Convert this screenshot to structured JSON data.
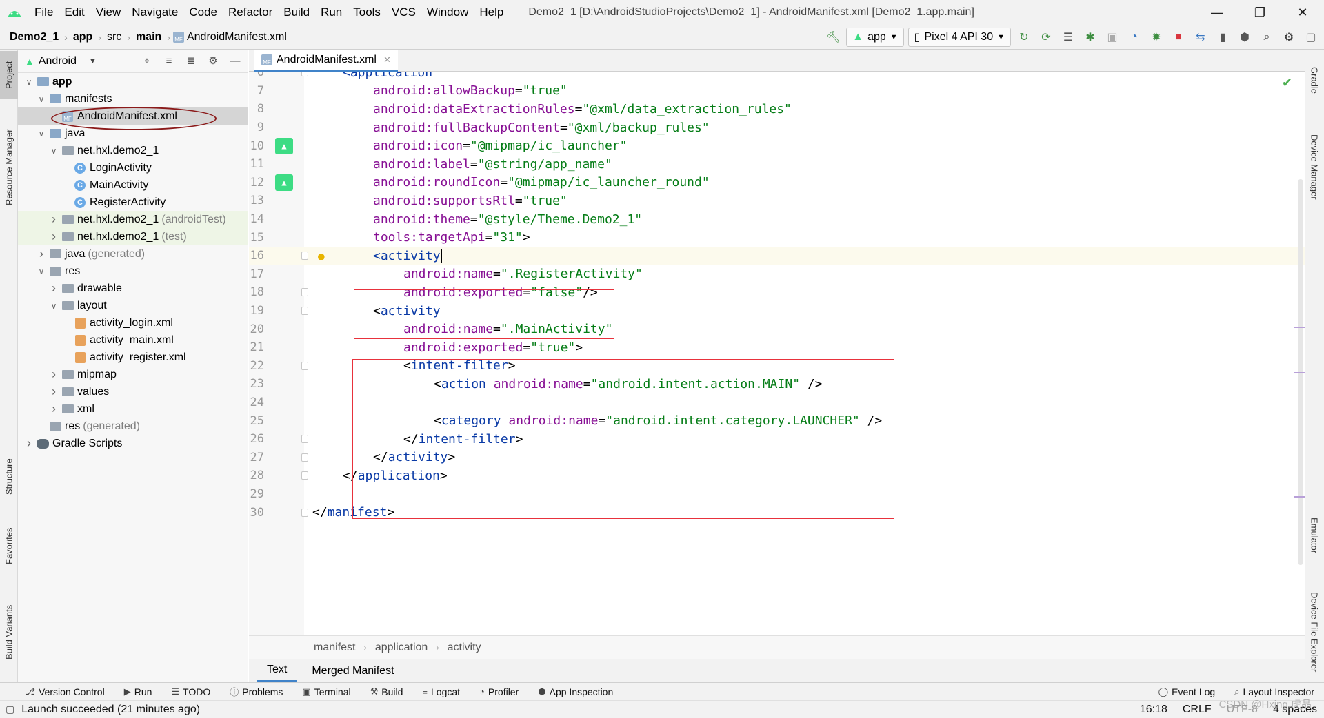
{
  "menu": {
    "items": [
      "File",
      "Edit",
      "View",
      "Navigate",
      "Code",
      "Refactor",
      "Build",
      "Run",
      "Tools",
      "VCS",
      "Window",
      "Help"
    ],
    "window_title": "Demo2_1 [D:\\AndroidStudioProjects\\Demo2_1] - AndroidManifest.xml [Demo2_1.app.main]"
  },
  "navbar": {
    "crumbs": [
      "Demo2_1",
      "app",
      "src",
      "main",
      "AndroidManifest.xml"
    ],
    "run_config": "app",
    "device": "Pixel 4 API 30"
  },
  "left_stripe": {
    "tabs": [
      "Project",
      "Resource Manager",
      "Structure",
      "Favorites",
      "Build Variants"
    ]
  },
  "right_stripe": {
    "tabs": [
      "Gradle",
      "Device Manager",
      "Emulator",
      "Device File Explorer"
    ]
  },
  "project_panel": {
    "view": "Android",
    "tree": [
      {
        "label": "app",
        "extra": "",
        "indent": 0,
        "arrow": "v",
        "icon": "folder-module",
        "bold": true
      },
      {
        "label": "manifests",
        "extra": "",
        "indent": 1,
        "arrow": "v",
        "icon": "folder"
      },
      {
        "label": "AndroidManifest.xml",
        "extra": "",
        "indent": 2,
        "arrow": "",
        "icon": "manifest",
        "selected": true
      },
      {
        "label": "java",
        "extra": "",
        "indent": 1,
        "arrow": "v",
        "icon": "folder"
      },
      {
        "label": "net.hxl.demo2_1",
        "extra": "",
        "indent": 2,
        "arrow": "v",
        "icon": "package"
      },
      {
        "label": "LoginActivity",
        "extra": "",
        "indent": 3,
        "arrow": "",
        "icon": "class"
      },
      {
        "label": "MainActivity",
        "extra": "",
        "indent": 3,
        "arrow": "",
        "icon": "class"
      },
      {
        "label": "RegisterActivity",
        "extra": "",
        "indent": 3,
        "arrow": "",
        "icon": "class"
      },
      {
        "label": "net.hxl.demo2_1",
        "extra": "(androidTest)",
        "indent": 2,
        "arrow": ">",
        "icon": "package",
        "green": true
      },
      {
        "label": "net.hxl.demo2_1",
        "extra": "(test)",
        "indent": 2,
        "arrow": ">",
        "icon": "package",
        "green": true
      },
      {
        "label": "java",
        "extra": "(generated)",
        "indent": 1,
        "arrow": ">",
        "icon": "folder-gray"
      },
      {
        "label": "res",
        "extra": "",
        "indent": 1,
        "arrow": "v",
        "icon": "folder-gray"
      },
      {
        "label": "drawable",
        "extra": "",
        "indent": 2,
        "arrow": ">",
        "icon": "package"
      },
      {
        "label": "layout",
        "extra": "",
        "indent": 2,
        "arrow": "v",
        "icon": "package"
      },
      {
        "label": "activity_login.xml",
        "extra": "",
        "indent": 3,
        "arrow": "",
        "icon": "xml"
      },
      {
        "label": "activity_main.xml",
        "extra": "",
        "indent": 3,
        "arrow": "",
        "icon": "xml"
      },
      {
        "label": "activity_register.xml",
        "extra": "",
        "indent": 3,
        "arrow": "",
        "icon": "xml"
      },
      {
        "label": "mipmap",
        "extra": "",
        "indent": 2,
        "arrow": ">",
        "icon": "package"
      },
      {
        "label": "values",
        "extra": "",
        "indent": 2,
        "arrow": ">",
        "icon": "package"
      },
      {
        "label": "xml",
        "extra": "",
        "indent": 2,
        "arrow": ">",
        "icon": "package"
      },
      {
        "label": "res",
        "extra": "(generated)",
        "indent": 1,
        "arrow": "",
        "icon": "folder-gray"
      },
      {
        "label": "Gradle Scripts",
        "extra": "",
        "indent": 0,
        "arrow": ">",
        "icon": "gradle"
      }
    ]
  },
  "editor": {
    "tab": "AndroidManifest.xml",
    "current_line": 16,
    "lines": [
      {
        "n": 6,
        "indent": 1,
        "tokens": [
          [
            "tag",
            "<application"
          ]
        ]
      },
      {
        "n": 7,
        "indent": 2,
        "tokens": [
          [
            "attr",
            "android:allowBackup"
          ],
          [
            "pun",
            "="
          ],
          [
            "val",
            "\"true\""
          ]
        ]
      },
      {
        "n": 8,
        "indent": 2,
        "tokens": [
          [
            "attr",
            "android:dataExtractionRules"
          ],
          [
            "pun",
            "="
          ],
          [
            "val",
            "\"@xml/data_extraction_rules\""
          ]
        ]
      },
      {
        "n": 9,
        "indent": 2,
        "tokens": [
          [
            "attr",
            "android:fullBackupContent"
          ],
          [
            "pun",
            "="
          ],
          [
            "val",
            "\"@xml/backup_rules\""
          ]
        ]
      },
      {
        "n": 10,
        "indent": 2,
        "tokens": [
          [
            "attr",
            "android:icon"
          ],
          [
            "pun",
            "="
          ],
          [
            "val",
            "\"@mipmap/ic_launcher\""
          ]
        ]
      },
      {
        "n": 11,
        "indent": 2,
        "tokens": [
          [
            "attr",
            "android:label"
          ],
          [
            "pun",
            "="
          ],
          [
            "val",
            "\"@string/app_name\""
          ]
        ]
      },
      {
        "n": 12,
        "indent": 2,
        "tokens": [
          [
            "attr",
            "android:roundIcon"
          ],
          [
            "pun",
            "="
          ],
          [
            "val",
            "\"@mipmap/ic_launcher_round\""
          ]
        ]
      },
      {
        "n": 13,
        "indent": 2,
        "tokens": [
          [
            "attr",
            "android:supportsRtl"
          ],
          [
            "pun",
            "="
          ],
          [
            "val",
            "\"true\""
          ]
        ]
      },
      {
        "n": 14,
        "indent": 2,
        "tokens": [
          [
            "attr",
            "android:theme"
          ],
          [
            "pun",
            "="
          ],
          [
            "val",
            "\"@style/Theme.Demo2_1\""
          ]
        ]
      },
      {
        "n": 15,
        "indent": 2,
        "tokens": [
          [
            "attr",
            "tools:targetApi"
          ],
          [
            "pun",
            "="
          ],
          [
            "val",
            "\"31\""
          ],
          [
            "pun",
            ">"
          ]
        ]
      },
      {
        "n": 16,
        "indent": 2,
        "tokens": [
          [
            "tag",
            "<activity"
          ]
        ],
        "cursor": true
      },
      {
        "n": 17,
        "indent": 3,
        "tokens": [
          [
            "attr",
            "android:name"
          ],
          [
            "pun",
            "="
          ],
          [
            "val",
            "\".RegisterActivity\""
          ]
        ]
      },
      {
        "n": 18,
        "indent": 3,
        "tokens": [
          [
            "attr",
            "android:exported"
          ],
          [
            "pun",
            "="
          ],
          [
            "val",
            "\"false\""
          ],
          [
            "pun",
            "/>"
          ]
        ]
      },
      {
        "n": 19,
        "indent": 2,
        "tokens": [
          [
            "pun",
            "<"
          ],
          [
            "tag",
            "activity"
          ]
        ]
      },
      {
        "n": 20,
        "indent": 3,
        "tokens": [
          [
            "attr",
            "android:name"
          ],
          [
            "pun",
            "="
          ],
          [
            "val",
            "\".MainActivity\""
          ]
        ]
      },
      {
        "n": 21,
        "indent": 3,
        "tokens": [
          [
            "attr",
            "android:exported"
          ],
          [
            "pun",
            "="
          ],
          [
            "val",
            "\"true\""
          ],
          [
            "pun",
            ">"
          ]
        ]
      },
      {
        "n": 22,
        "indent": 3,
        "tokens": [
          [
            "pun",
            "<"
          ],
          [
            "tag",
            "intent-filter"
          ],
          [
            "pun",
            ">"
          ]
        ]
      },
      {
        "n": 23,
        "indent": 4,
        "tokens": [
          [
            "pun",
            "<"
          ],
          [
            "tag",
            "action "
          ],
          [
            "attr",
            "android:name"
          ],
          [
            "pun",
            "="
          ],
          [
            "val",
            "\"android.intent.action.MAIN\""
          ],
          [
            "pun",
            " />"
          ]
        ]
      },
      {
        "n": 24,
        "indent": 0,
        "tokens": []
      },
      {
        "n": 25,
        "indent": 4,
        "tokens": [
          [
            "pun",
            "<"
          ],
          [
            "tag",
            "category "
          ],
          [
            "attr",
            "android:name"
          ],
          [
            "pun",
            "="
          ],
          [
            "val",
            "\"android.intent.category.LAUNCHER\""
          ],
          [
            "pun",
            " />"
          ]
        ]
      },
      {
        "n": 26,
        "indent": 3,
        "tokens": [
          [
            "pun",
            "</"
          ],
          [
            "tag",
            "intent-filter"
          ],
          [
            "pun",
            ">"
          ]
        ]
      },
      {
        "n": 27,
        "indent": 2,
        "tokens": [
          [
            "pun",
            "</"
          ],
          [
            "tag",
            "activity"
          ],
          [
            "pun",
            ">"
          ]
        ]
      },
      {
        "n": 28,
        "indent": 1,
        "tokens": [
          [
            "pun",
            "</"
          ],
          [
            "tag",
            "application"
          ],
          [
            "pun",
            ">"
          ]
        ]
      },
      {
        "n": 29,
        "indent": 0,
        "tokens": []
      },
      {
        "n": 30,
        "indent": 0,
        "tokens": [
          [
            "pun",
            "</"
          ],
          [
            "tag",
            "manifest"
          ],
          [
            "pun",
            ">"
          ]
        ]
      }
    ],
    "breadcrumb": [
      "manifest",
      "application",
      "activity"
    ],
    "bottom_tabs": [
      "Text",
      "Merged Manifest"
    ]
  },
  "tool_windows": {
    "left": [
      "Version Control",
      "Run",
      "TODO",
      "Problems",
      "Terminal",
      "Build",
      "Logcat",
      "Profiler",
      "App Inspection"
    ],
    "right": [
      "Event Log",
      "Layout Inspector"
    ]
  },
  "status": {
    "message": "Launch succeeded (21 minutes ago)",
    "position": "16:18",
    "line_sep": "CRLF",
    "encoding": "UTF-8",
    "indent": "4 spaces",
    "watermark": "CSDN @Hxjng.虎晶"
  },
  "colors": {
    "tag": "#0a3aa6",
    "attr": "#871094",
    "value": "#067d17",
    "highlight_box": "#e8323c",
    "annotation_ellipse": "#8b1a1a"
  }
}
